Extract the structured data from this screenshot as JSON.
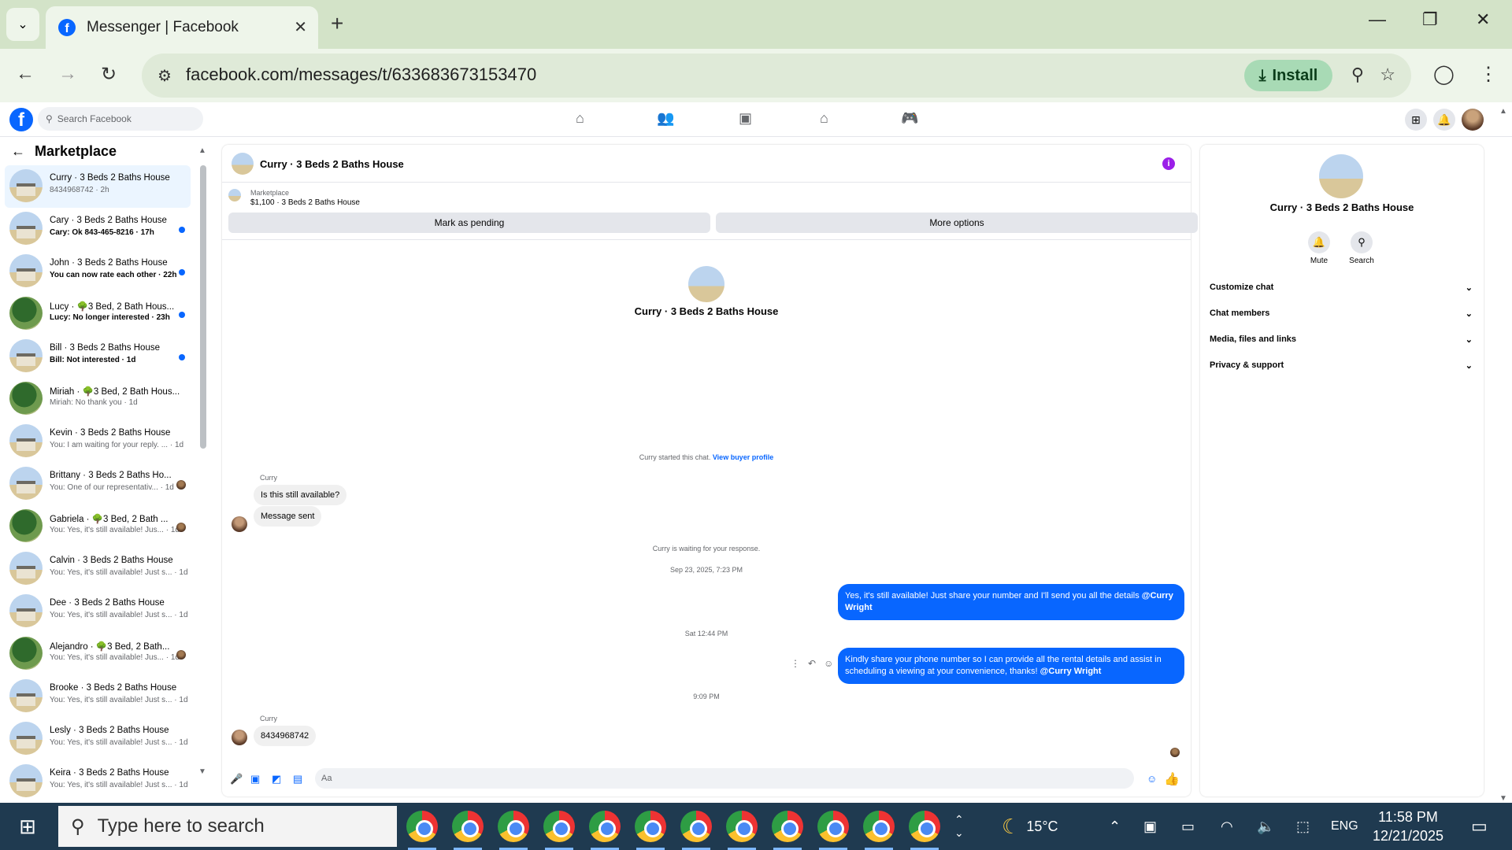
{
  "browser": {
    "tab_title": "Messenger | Facebook",
    "url": "facebook.com/messages/t/633683673153470",
    "install_label": "Install"
  },
  "facebook": {
    "search_placeholder": "Search Facebook"
  },
  "sidebar": {
    "title": "Marketplace",
    "conversations": [
      {
        "name": "Curry · 3 Beds 2 Baths House",
        "sub": "8434968742 · 2h",
        "avatar": "house",
        "indicator": "none",
        "active": true
      },
      {
        "name": "Cary · 3 Beds 2 Baths House",
        "sub": "Cary: Ok 843-465-8216 · 17h",
        "avatar": "house",
        "indicator": "unread"
      },
      {
        "name": "John · 3 Beds 2 Baths House",
        "sub": "You can now rate each other · 22h",
        "avatar": "house",
        "indicator": "unread"
      },
      {
        "name": "Lucy · 🌳3 Bed, 2 Bath Hous...",
        "sub": "Lucy: No longer interested · 23h",
        "avatar": "tree",
        "indicator": "unread"
      },
      {
        "name": "Bill · 3 Beds 2 Baths House",
        "sub": "Bill: Not interested · 1d",
        "avatar": "house",
        "indicator": "unread"
      },
      {
        "name": "Miriah · 🌳3 Bed, 2 Bath Hous...",
        "sub": "Miriah: No thank you · 1d",
        "avatar": "tree",
        "indicator": "none"
      },
      {
        "name": "Kevin · 3 Beds 2 Baths House",
        "sub": "You: I am waiting for your reply. ... · 1d",
        "avatar": "house",
        "indicator": "none"
      },
      {
        "name": "Brittany · 3 Beds 2 Baths Ho...",
        "sub": "You: One of our representativ... · 1d",
        "avatar": "house",
        "indicator": "seen"
      },
      {
        "name": "Gabriela · 🌳3 Bed, 2 Bath ...",
        "sub": "You: Yes, it's still available! Jus... · 1d",
        "avatar": "tree",
        "indicator": "seen"
      },
      {
        "name": "Calvin · 3 Beds 2 Baths House",
        "sub": "You: Yes, it's still available! Just s... · 1d",
        "avatar": "house",
        "indicator": "none"
      },
      {
        "name": "Dee · 3 Beds 2 Baths House",
        "sub": "You: Yes, it's still available! Just s... · 1d",
        "avatar": "house",
        "indicator": "none"
      },
      {
        "name": "Alejandro · 🌳3 Bed, 2 Bath...",
        "sub": "You: Yes, it's still available! Jus... · 1d",
        "avatar": "tree",
        "indicator": "seen"
      },
      {
        "name": "Brooke · 3 Beds 2 Baths House",
        "sub": "You: Yes, it's still available! Just s... · 1d",
        "avatar": "house",
        "indicator": "none"
      },
      {
        "name": "Lesly · 3 Beds 2 Baths House",
        "sub": "You: Yes, it's still available! Just s... · 1d",
        "avatar": "house",
        "indicator": "none"
      },
      {
        "name": "Keira · 3 Beds 2 Baths House",
        "sub": "You: Yes, it's still available! Just s... · 1d",
        "avatar": "house",
        "indicator": "none"
      }
    ]
  },
  "chat": {
    "title": "Curry · 3 Beds 2 Baths House",
    "marketplace_label": "Marketplace",
    "listing": "$1,100 · 3 Beds 2 Baths House",
    "mark_pending": "Mark as pending",
    "more_options": "More options",
    "profile_name": "Curry · 3 Beds 2 Baths House",
    "started_text": "Curry started this chat.",
    "view_buyer_profile": "View buyer profile",
    "sender_name": "Curry",
    "msg_in_1": "Is this still available?",
    "msg_in_2": "Message sent",
    "waiting_text": "Curry is waiting for your response.",
    "time_1": "Sep 23, 2025, 7:23 PM",
    "msg_out_1": "Yes, it's still available! Just share your number and I'll send you all the details",
    "mention": "@Curry Wright",
    "time_2": "Sat 12:44 PM",
    "msg_out_2": "Kindly share your phone number so I can provide all the rental details and assist in scheduling a viewing at your convenience, thanks!",
    "time_3": "9:09 PM",
    "msg_in_3": "8434968742",
    "composer_placeholder": "Aa"
  },
  "info_panel": {
    "name": "Curry · 3 Beds 2 Baths House",
    "mute": "Mute",
    "search": "Search",
    "rows": [
      "Customize chat",
      "Chat members",
      "Media, files and links",
      "Privacy & support"
    ]
  },
  "taskbar": {
    "search_placeholder": "Type here to search",
    "weather": "15°C",
    "language": "ENG",
    "time": "11:58 PM",
    "date": "12/21/2025",
    "chrome_instances": 12
  }
}
